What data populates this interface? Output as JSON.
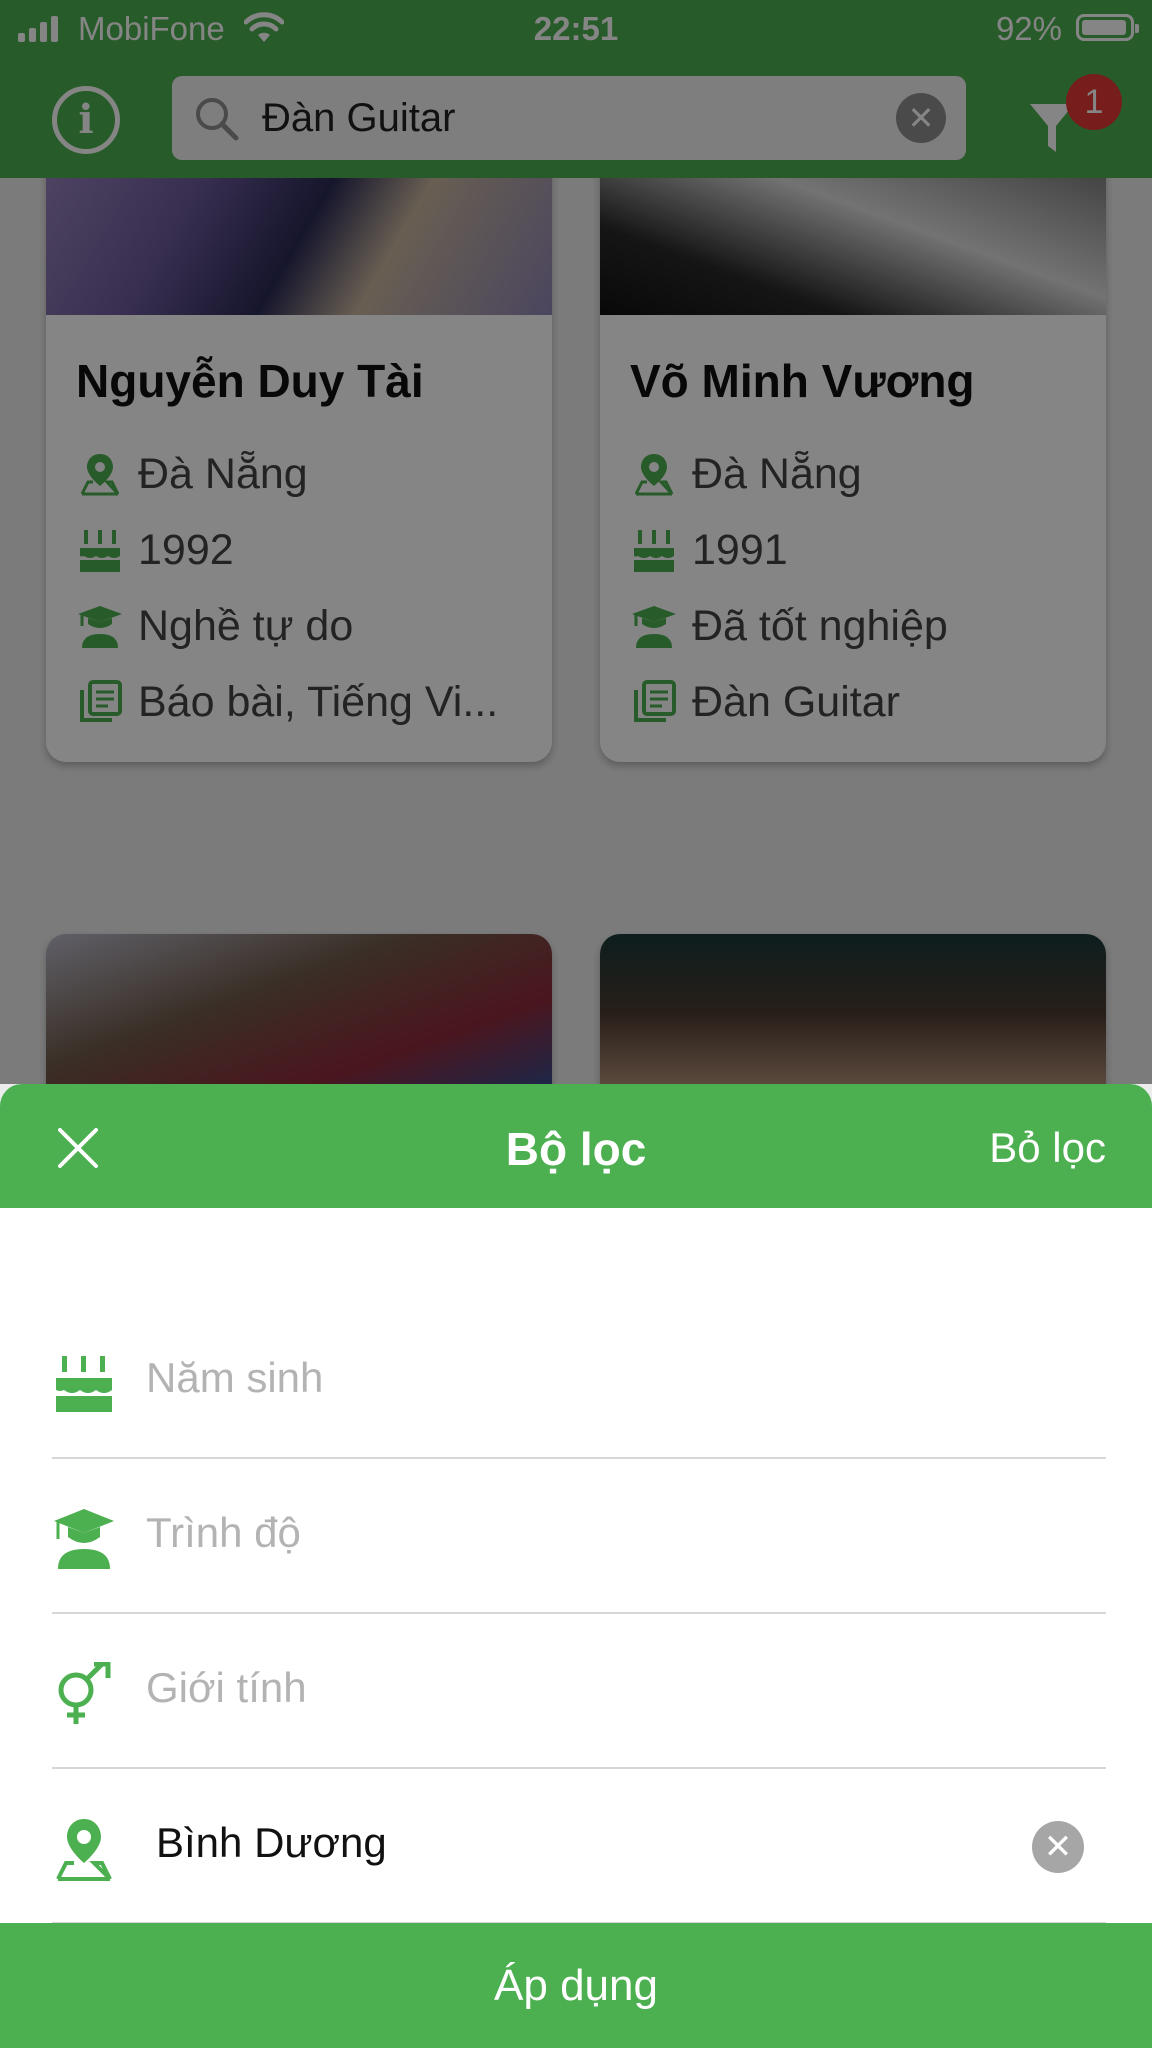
{
  "status_bar": {
    "carrier": "MobiFone",
    "time": "22:51",
    "battery": "92%"
  },
  "header": {
    "search_value": "Đàn Guitar",
    "filter_badge": "1"
  },
  "cards": [
    {
      "name": "Nguyễn Duy Tài",
      "location": "Đà Nẵng",
      "birth_year": "1992",
      "education": "Nghề tự do",
      "subjects": "Báo bài, Tiếng Vi..."
    },
    {
      "name": "Võ Minh Vương",
      "location": "Đà Nẵng",
      "birth_year": "1991",
      "education": "Đã tốt nghiệp",
      "subjects": "Đàn Guitar"
    }
  ],
  "filter_sheet": {
    "title": "Bộ lọc",
    "clear_label": "Bỏ lọc",
    "birth_year_placeholder": "Năm sinh",
    "level_placeholder": "Trình độ",
    "gender_placeholder": "Giới tính",
    "location_value": "Bình Dương",
    "apply_label": "Áp dụng"
  },
  "colors": {
    "primary_green": "#4caf50",
    "badge_red": "#e53935"
  },
  "icons": {
    "info": "info-icon",
    "search": "search-icon",
    "filter": "filter-icon",
    "location": "location-pin-icon",
    "birthday": "birthday-cake-icon",
    "education": "graduate-icon",
    "subjects": "book-icon",
    "gender": "gender-icon",
    "close": "close-icon"
  }
}
